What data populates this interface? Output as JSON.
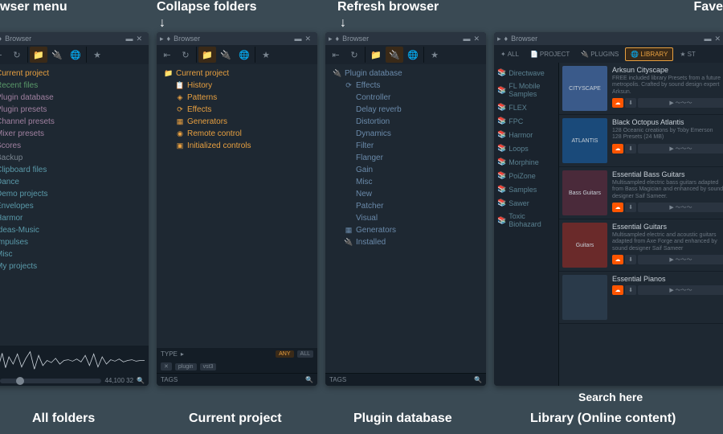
{
  "labels": {
    "top_menu": "wser menu",
    "top_collapse": "Collapse folders",
    "top_refresh": "Refresh browser",
    "top_fav": "Fave",
    "bottom_all": "All folders",
    "bottom_current": "Current project",
    "bottom_plugin": "Plugin database",
    "bottom_library": "Library (Online content)",
    "bottom_search": "Search here"
  },
  "common": {
    "browser": "Browser",
    "tags": "TAGS",
    "type": "TYPE",
    "any": "ANY",
    "all": "ALL",
    "plugin": "plugin",
    "vst3": "vst3",
    "waveinfo": "44,100 32"
  },
  "panel1": {
    "items": [
      {
        "t": "Current project",
        "c": "c-orange"
      },
      {
        "t": "Recent files",
        "c": "c-green"
      },
      {
        "t": "Plugin database",
        "c": "c-purple"
      },
      {
        "t": "Plugin presets",
        "c": "c-purple"
      },
      {
        "t": "Channel presets",
        "c": "c-purple"
      },
      {
        "t": "Mixer presets",
        "c": "c-purple"
      },
      {
        "t": "Scores",
        "c": "c-purple"
      },
      {
        "t": "Backup",
        "c": "c-gray"
      },
      {
        "t": "Clipboard files",
        "c": "c-teal"
      },
      {
        "t": "Dance",
        "c": "c-teal"
      },
      {
        "t": "Demo projects",
        "c": "c-teal"
      },
      {
        "t": "Envelopes",
        "c": "c-teal"
      },
      {
        "t": "Harmor",
        "c": "c-teal"
      },
      {
        "t": "Ideas-Music",
        "c": "c-teal"
      },
      {
        "t": "Impulses",
        "c": "c-teal"
      },
      {
        "t": "Misc",
        "c": "c-teal"
      },
      {
        "t": "My projects",
        "c": "c-teal"
      }
    ]
  },
  "panel2": {
    "header": "Current project",
    "items": [
      {
        "t": "History",
        "i": "📋"
      },
      {
        "t": "Patterns",
        "i": "◈"
      },
      {
        "t": "Effects",
        "i": "⟳"
      },
      {
        "t": "Generators",
        "i": "▦"
      },
      {
        "t": "Remote control",
        "i": "◉"
      },
      {
        "t": "Initialized controls",
        "i": "▣"
      }
    ]
  },
  "panel3": {
    "header": "Plugin database",
    "sub": "Effects",
    "items": [
      "Controller",
      "Delay reverb",
      "Distortion",
      "Dynamics",
      "Filter",
      "Flanger",
      "Gain",
      "Misc",
      "New",
      "Patcher",
      "Visual"
    ],
    "gen": "Generators",
    "inst": "Installed"
  },
  "panel4": {
    "tabs": {
      "all": "ALL",
      "project": "PROJECT",
      "plugins": "PLUGINS",
      "library": "LIBRARY",
      "star": "ST"
    },
    "side": [
      "Directwave",
      "FL Mobile Samples",
      "FLEX",
      "FPC",
      "Harmor",
      "Loops",
      "Morphine",
      "PoiZone",
      "Samples",
      "Sawer",
      "Toxic Biohazard"
    ],
    "items": [
      {
        "title": "Arksun Cityscape",
        "desc": "FREE included library Presets from a future metropolis. Crafted by sound design expert Arksun.",
        "thumb": "CITYSCAPE",
        "bg": "#3a5a8a"
      },
      {
        "title": "Black Octopus Atlantis",
        "desc": "128 Oceanic creations by Toby Emerson 128 Presets (24 MB)",
        "thumb": "ATLANTIS",
        "bg": "#1a4a7a"
      },
      {
        "title": "Essential Bass Guitars",
        "desc": "Multisampled electric bass guitars adapted from Bass Magician and enhanced by sound designer Saif Sameer.",
        "thumb": "Bass Guitars",
        "bg": "#4a2a3a"
      },
      {
        "title": "Essential Guitars",
        "desc": "Multisampled electric and acoustic guitars adapted from Axe Forge and enhanced by sound designer Saif Sameer",
        "thumb": "Guitars",
        "bg": "#6a2a2a"
      },
      {
        "title": "Essential Pianos",
        "desc": "",
        "thumb": "",
        "bg": "#2a3a4a"
      }
    ]
  }
}
